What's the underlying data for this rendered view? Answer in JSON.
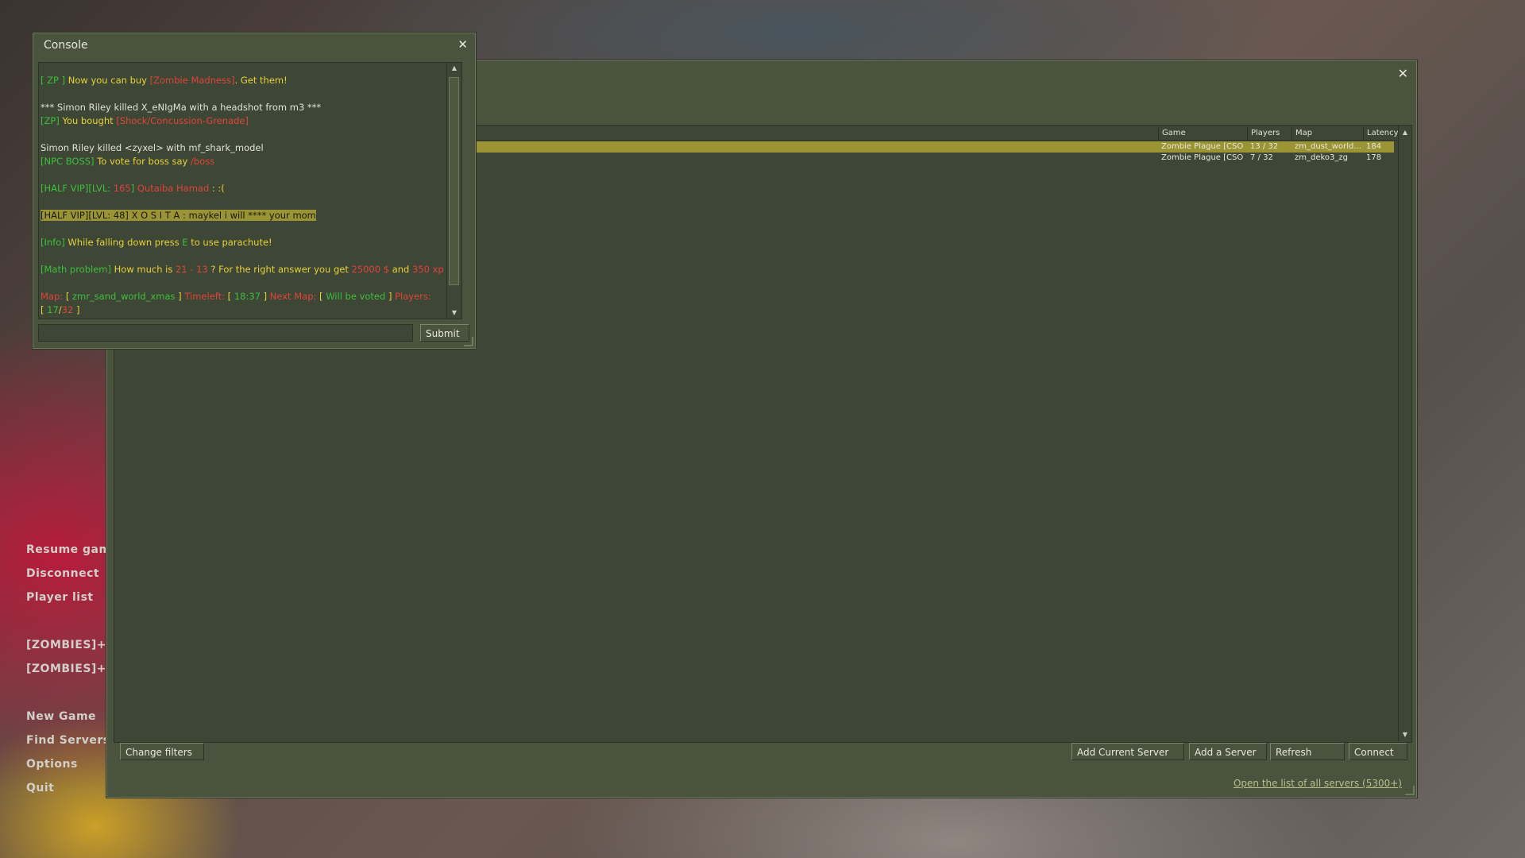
{
  "menu": {
    "items": [
      "Resume game",
      "Disconnect",
      "Player list",
      "[ZOMBIES]+[Z",
      "[ZOMBIES]+[Z",
      "New Game",
      "Find Servers",
      "Options",
      "Quit"
    ]
  },
  "browser": {
    "close_glyph": "✕",
    "columns": {
      "game": "Game",
      "players": "Players",
      "map": "Map",
      "latency": "Latency"
    },
    "rows": [
      {
        "game": "Zombie Plague [CSO]",
        "players": "13 / 32",
        "map": "zm_dust_world...",
        "latency": "184"
      },
      {
        "game": "Zombie Plague [CSO]",
        "players": "7 / 32",
        "map": "zm_deko3_zg",
        "latency": "178"
      }
    ],
    "buttons": {
      "change_filters": "Change filters",
      "add_current": "Add Current Server",
      "add_server": "Add a Server",
      "refresh": "Refresh",
      "connect": "Connect"
    },
    "all_servers_link": "Open the list of all servers (5300+)"
  },
  "console": {
    "title": "Console",
    "close_glyph": "✕",
    "submit_label": "Submit",
    "input_value": "",
    "colors": {
      "white": "#dfe3d4",
      "green": "#3fbf3f",
      "red": "#e0443a",
      "yellow": "#e8d23a",
      "highlight": "#9a9434"
    },
    "lines": [
      {
        "segs": [
          [
            "g",
            "[ ZP ]"
          ],
          [
            "y",
            " Now you can buy "
          ],
          [
            "r",
            "[Zombie Madness]"
          ],
          [
            "y",
            ". Get them!"
          ]
        ]
      },
      {
        "gap": true
      },
      {
        "segs": [
          [
            "w",
            "*** Simon Riley killed X_eNIgMa with a headshot from m3 ***"
          ]
        ]
      },
      {
        "segs": [
          [
            "g",
            "[ZP]"
          ],
          [
            "y",
            " You bought "
          ],
          [
            "r",
            "[Shock/Concussion-Grenade]"
          ]
        ]
      },
      {
        "gap": true
      },
      {
        "segs": [
          [
            "w",
            "Simon Riley killed <zyxel> with mf_shark_model"
          ]
        ]
      },
      {
        "segs": [
          [
            "g",
            "[NPC BOSS]"
          ],
          [
            "y",
            " To vote for boss say "
          ],
          [
            "r",
            "/boss"
          ]
        ]
      },
      {
        "gap": true
      },
      {
        "segs": [
          [
            "g",
            "[HALF VIP][LVL: "
          ],
          [
            "r",
            "165"
          ],
          [
            "g",
            "]"
          ],
          [
            "r",
            " Qutaiba Hamad"
          ],
          [
            "y",
            " :  :("
          ]
        ]
      },
      {
        "gap": true
      },
      {
        "highlight": true,
        "segs": [
          [
            "w",
            "[HALF VIP][LVL: 48] X O S I T A :  maykel i will **** your mom"
          ]
        ]
      },
      {
        "gap": true
      },
      {
        "segs": [
          [
            "g",
            "[Info]"
          ],
          [
            "y",
            " While falling down press "
          ],
          [
            "g",
            "E"
          ],
          [
            "y",
            " to use parachute!"
          ]
        ]
      },
      {
        "gap": true
      },
      {
        "segs": [
          [
            "g",
            "[Math problem]"
          ],
          [
            "y",
            " How much is "
          ],
          [
            "r",
            "21 - 13"
          ],
          [
            "y",
            " ? For the right answer you get "
          ],
          [
            "r",
            "25000 $"
          ],
          [
            "y",
            " and "
          ],
          [
            "r",
            "350 xp"
          ]
        ]
      },
      {
        "gap": true
      },
      {
        "segs": [
          [
            "r",
            "Map: "
          ],
          [
            "y",
            "[ "
          ],
          [
            "g",
            "zmr_sand_world_xmas"
          ],
          [
            "y",
            " ]"
          ],
          [
            "r",
            " Timeleft: "
          ],
          [
            "y",
            "[ "
          ],
          [
            "g",
            "18:37"
          ],
          [
            "y",
            " ]"
          ],
          [
            "r",
            " Next Map: "
          ],
          [
            "y",
            "[ "
          ],
          [
            "g",
            "Will be voted"
          ],
          [
            "y",
            " ]"
          ],
          [
            "r",
            " Players:"
          ]
        ]
      },
      {
        "segs": [
          [
            "y",
            "[ "
          ],
          [
            "g",
            "17"
          ],
          [
            "y",
            "/"
          ],
          [
            "r",
            "32"
          ],
          [
            "y",
            " ]"
          ]
        ]
      }
    ]
  }
}
